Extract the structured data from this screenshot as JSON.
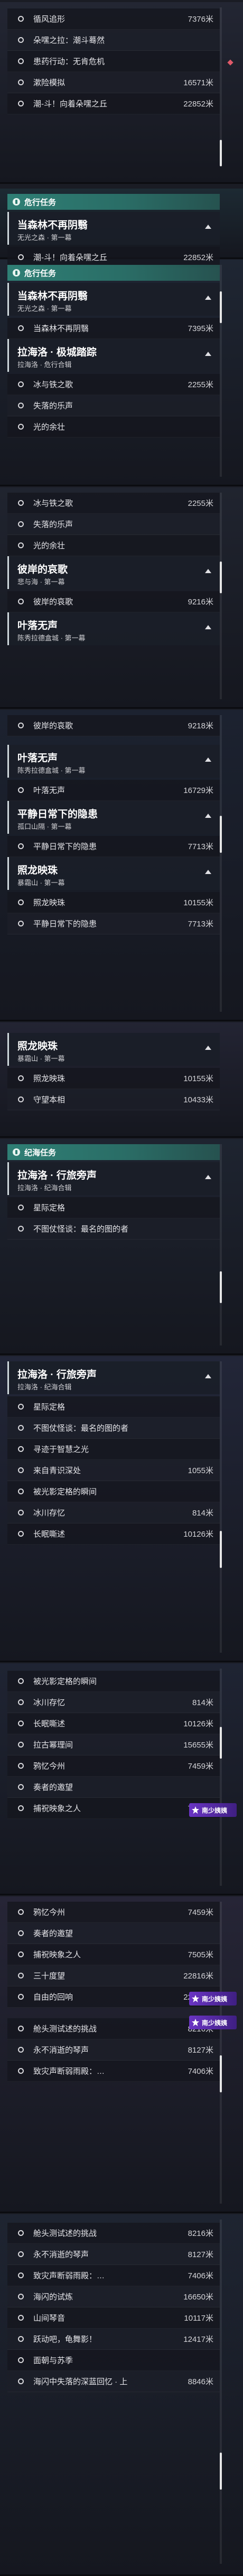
{
  "categories": {
    "wandering": "危行任务",
    "main": "纪海任务"
  },
  "badge_label": "南少姨姨",
  "panels": [
    {
      "rows": [
        {
          "name": "循风追形",
          "dist": "7376米"
        },
        {
          "name": "朵嘿之拉：潮斗蓦然",
          "dist": ""
        },
        {
          "name": "患药行动：无肯危机",
          "dist": ""
        },
        {
          "name": "漱险模拟",
          "dist": "16571米"
        },
        {
          "name": "潮-斗！向着朵嘿之丘",
          "dist": "22852米"
        }
      ]
    },
    {
      "category": "wandering",
      "selected": {
        "title": "当森林不再阴翳",
        "sub": "无光之森 · 第一幕"
      },
      "rows": [
        {
          "name": "潮-斗！向着朵嘿之丘",
          "dist": "22852米"
        }
      ]
    },
    {
      "category": "wandering",
      "selected": {
        "title": "当森林不再阴翳",
        "sub": "无光之森 · 第一幕"
      },
      "rows": [
        {
          "name": "当森林不再阴翳",
          "dist": "7395米"
        }
      ],
      "selected2": {
        "title": "拉海洛 · 极城踏踪",
        "sub": "拉海洛 · 危行合辑"
      },
      "rows2": [
        {
          "name": "冰与铁之歌",
          "dist": "2255米"
        },
        {
          "name": "失落的乐声",
          "dist": ""
        },
        {
          "name": "光的余壮",
          "dist": ""
        }
      ]
    },
    {
      "rows": [
        {
          "name": "冰与铁之歌",
          "dist": "2255米"
        },
        {
          "name": "失落的乐声",
          "dist": ""
        },
        {
          "name": "光的余壮",
          "dist": ""
        }
      ],
      "selected": {
        "title": "彼岸的哀歌",
        "sub": "悲与海 · 第一幕"
      },
      "rows2": [
        {
          "name": "彼岸的哀歌",
          "dist": "9216米"
        }
      ],
      "selected2": {
        "title": "叶落无声",
        "sub": "陈秀拉德盒城 · 第一幕"
      }
    },
    {
      "rows": [
        {
          "name": "彼岸的哀歌",
          "dist": "9218米"
        }
      ],
      "selected": {
        "title": "叶落无声",
        "sub": "陈秀拉德盒城 · 第一幕"
      },
      "rows2": [
        {
          "name": "叶落无声",
          "dist": "16729米"
        }
      ],
      "selected2": {
        "title": "平静日常下的隐患",
        "sub": "孤口山隔 · 第一幕"
      },
      "rows3": [
        {
          "name": "平静日常下的隐患",
          "dist": "7713米"
        }
      ],
      "selected3": {
        "title": "照龙映珠",
        "sub": "暴霜山 · 第一幕"
      },
      "rows4": [
        {
          "name": "照龙映珠",
          "dist": "10155米"
        },
        {
          "name": "平静日常下的隐患",
          "dist": "7713米"
        }
      ]
    },
    {
      "selected": {
        "title": "照龙映珠",
        "sub": "暴霜山 · 第一幕"
      },
      "rows": [
        {
          "name": "照龙映珠",
          "dist": "10155米"
        },
        {
          "name": "守望本相",
          "dist": "10433米"
        }
      ]
    },
    {
      "category": "main",
      "selected": {
        "title": "拉海洛 · 行旅旁声",
        "sub": "拉海洛 · 纪海合辑"
      },
      "rows": [
        {
          "name": "星际定格",
          "dist": ""
        },
        {
          "name": "不图仗怪谈：最名的图的者",
          "dist": ""
        }
      ]
    },
    {
      "selected": {
        "title": "拉海洛 · 行旅旁声",
        "sub": "拉海洛 · 纪海合辑"
      },
      "rows": [
        {
          "name": "星际定格",
          "dist": ""
        },
        {
          "name": "不图仗怪谈：最名的图的者",
          "dist": ""
        },
        {
          "name": "寻迹于智慧之光",
          "dist": ""
        },
        {
          "name": "来自青识深处",
          "dist": "1055米"
        },
        {
          "name": "被光影定格的瞬间",
          "dist": ""
        },
        {
          "name": "冰川存忆",
          "dist": "814米"
        },
        {
          "name": "长眠嘶述",
          "dist": "10126米"
        }
      ]
    },
    {
      "rows": [
        {
          "name": "被光影定格的瞬间",
          "dist": ""
        },
        {
          "name": "冰川存忆",
          "dist": "814米"
        },
        {
          "name": "长眠嘶述",
          "dist": "10126米"
        },
        {
          "name": "拉古幂理间",
          "dist": "15655米"
        },
        {
          "name": "鸦忆今州",
          "dist": "7459米"
        },
        {
          "name": "奏者的邀望",
          "dist": ""
        },
        {
          "name": "捕祝映象之人",
          "dist": "7505米"
        }
      ]
    },
    {
      "rows": [
        {
          "name": "鸦忆今州",
          "dist": "7459米"
        },
        {
          "name": "奏者的邀望",
          "dist": ""
        },
        {
          "name": "捕祝映象之人",
          "dist": "7505米"
        },
        {
          "name": "三十度望",
          "dist": "22816米"
        },
        {
          "name": "自由的回响",
          "dist": "22994米"
        },
        {
          "name": "",
          "dist": ""
        },
        {
          "name": "舱头测试述的挑战",
          "dist": "8216米"
        },
        {
          "name": "永不消逝的琴声",
          "dist": "8127米"
        },
        {
          "name": "致灾声断弱雨殿：…",
          "dist": "7406米"
        }
      ]
    },
    {
      "rows": [
        {
          "name": "舱头测试述的挑战",
          "dist": "8216米"
        },
        {
          "name": "永不消逝的琴声",
          "dist": "8127米"
        },
        {
          "name": "致灾声断弱雨殿：…",
          "dist": "7406米"
        },
        {
          "name": "海闪的试炼",
          "dist": "16650米"
        },
        {
          "name": "山间琴音",
          "dist": "10117米"
        },
        {
          "name": "跃动吧，龟舞影！",
          "dist": "12417米"
        },
        {
          "name": "面朝与苏季",
          "dist": ""
        },
        {
          "name": "海闪中失落的深蓝回忆 · 上",
          "dist": "8846米"
        }
      ]
    }
  ]
}
